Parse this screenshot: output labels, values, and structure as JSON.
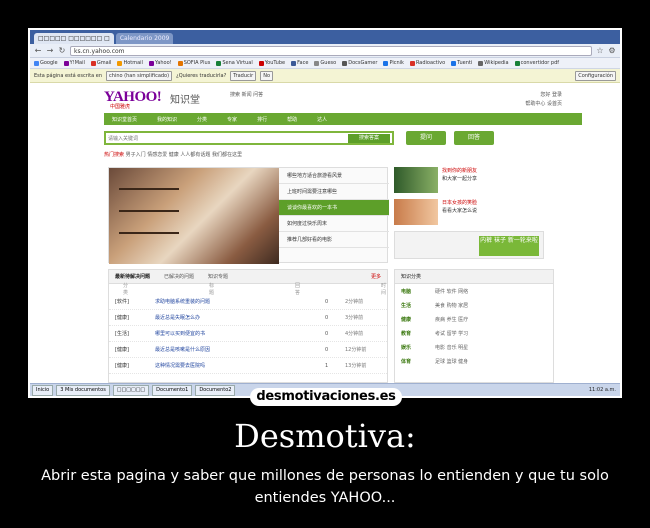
{
  "browser": {
    "tabs": [
      {
        "label": "□□□□□ □□□□□□ □"
      },
      {
        "label": "Calendario 2009"
      }
    ],
    "url": "ks.cn.yahoo.com",
    "bookmarks": [
      "Google",
      "Y!Mail",
      "Gmail",
      "Hotmail",
      "Yahoo!",
      "SOFIA Plus",
      "Sena Virtual",
      "YouTube",
      "Face",
      "Gueso",
      "DocsGamer",
      "Picnik",
      "Radioactivo",
      "Tuenti",
      "Wikipedia",
      "convertidor pdf"
    ],
    "translate": {
      "message": "Esta página está escrita en",
      "language": "chino (han simplificado)",
      "question": "¿Quieres traducirla?",
      "translate_btn": "Traducir",
      "no_btn": "No",
      "config_btn": "Configuración"
    }
  },
  "yahoo": {
    "logo": "YAHOO!",
    "logo_sub": "中国雅虎",
    "logo_product": "知识堂",
    "top_links": "搜索 新闻 问答",
    "user_links": [
      "您好 登录",
      "帮助中心 设首页"
    ],
    "nav": [
      "知识堂首页",
      "我的知识",
      "分类",
      "专家",
      "排行",
      "帮助",
      "达人"
    ],
    "search_placeholder": "请输入关键词",
    "search_btn": "搜索答案",
    "ask_btn": "提问",
    "answer_btn": "回答",
    "hot_label": "热门搜索",
    "hot_text": "男子入门 情感恋爱 健康 人人都有话题 我们都在这里",
    "feature_questions": [
      "哪些地方适合旅游看风景",
      "上班时间需要注意哪些",
      "谈谈你最喜欢的一本书",
      "如何度过快乐周末",
      "推荐几部好看的电影"
    ],
    "right_items": [
      {
        "title": "找到你的新朋友",
        "desc": "和大家一起分享"
      },
      {
        "title": "日本女孩的笑脸",
        "desc": "看看大家怎么说"
      }
    ],
    "promo_text": "内裤 袜子 新一轮来啦",
    "qa_tabs": [
      "最新待解决问题",
      "已解决的问题",
      "知识专题"
    ],
    "qa_more": "更多",
    "qa_headers": [
      "分类",
      "标题",
      "回答",
      "时间"
    ],
    "qa_rows": [
      {
        "cat": "[软件]",
        "title": "求助电脑系统重装的问题",
        "n": "0",
        "time": "2分钟前"
      },
      {
        "cat": "[健康]",
        "title": "最近总是失眠怎么办",
        "n": "0",
        "time": "3分钟前"
      },
      {
        "cat": "[生活]",
        "title": "哪里可以买到便宜的书",
        "n": "0",
        "time": "4分钟前"
      },
      {
        "cat": "[健康]",
        "title": "最近总是咳嗽是什么原因",
        "n": "0",
        "time": "12分钟前"
      },
      {
        "cat": "[健康]",
        "title": "这种情况需要去医院吗",
        "n": "1",
        "time": "13分钟前"
      }
    ],
    "cats_title": "知识分类",
    "categories": [
      {
        "name": "电脑",
        "subs": "硬件 软件 网络"
      },
      {
        "name": "生活",
        "subs": "美食 购物 家居"
      },
      {
        "name": "健康",
        "subs": "疾病 养生 医疗"
      },
      {
        "name": "教育",
        "subs": "考试 留学 学习"
      },
      {
        "name": "娱乐",
        "subs": "电影 音乐 明星"
      },
      {
        "name": "体育",
        "subs": "足球 篮球 健身"
      }
    ]
  },
  "taskbar": {
    "start": "Inicio",
    "tasks": [
      "3 Mis documentos",
      "□□□□□□",
      "Documento1",
      "Documento2"
    ],
    "clock": "11:02 a.m."
  },
  "watermark": "desmotivaciones.es",
  "poster": {
    "title": "Desmotiva:",
    "caption": "Abrir esta pagina y saber que millones de personas lo entienden y que tu solo entiendes YAHOO..."
  },
  "colors": {
    "yahoo_green": "#6aa832",
    "yahoo_purple": "#7b0099",
    "poster_bg": "#000000"
  }
}
